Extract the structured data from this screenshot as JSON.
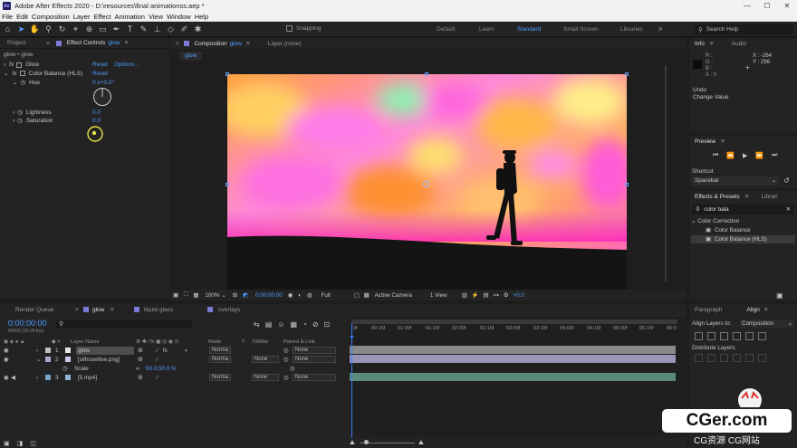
{
  "titlebar": {
    "logo": "Ae",
    "title": "Adobe After Effects 2020 - D:\\resources\\final animationss.aep *",
    "minimize": "—",
    "maximize": "☐",
    "close": "✕"
  },
  "menu": [
    "File",
    "Edit",
    "Composition",
    "Layer",
    "Effect",
    "Animation",
    "View",
    "Window",
    "Help"
  ],
  "toolbar": {
    "snapping_label": "Snapping",
    "workspaces": [
      "Default",
      "Learn",
      "Standard",
      "Small Screen",
      "Libraries"
    ],
    "active_workspace": "Standard",
    "search_placeholder": "Search Help"
  },
  "effect_controls": {
    "project_tab": "Project",
    "tab_prefix": "Effect Controls",
    "tab_layer": "glow",
    "breadcrumb": "glow • glow",
    "effects": [
      {
        "fx": "fx",
        "name": "Glow",
        "reset": "Reset",
        "options": "Options..."
      },
      {
        "fx": "fx",
        "name": "Color Balance (HLS)",
        "reset": "Reset"
      }
    ],
    "hue_label": "Hue",
    "hue_value": "0 x+0.0°",
    "lightness_label": "Lightness",
    "lightness_value": "0.0",
    "saturation_label": "Saturation",
    "saturation_value": "0.0"
  },
  "composition": {
    "tab_prefix": "Composition",
    "tab_name": "glow",
    "layer_tab": "Layer  (none)",
    "flow_label": "glow",
    "footer": {
      "zoom": "100%",
      "timecode": "0:00:00:00",
      "resolution": "Full",
      "camera": "Active Camera",
      "view": "1 View",
      "exposure": "+0.0"
    }
  },
  "info": {
    "tab": "Info",
    "audio_tab": "Audio",
    "r": "R :",
    "g": "G :",
    "b": "B :",
    "a": "A : 0",
    "x": "X : -264",
    "y": "Y : 296",
    "undo": "Undo",
    "change_value": "Change Value"
  },
  "preview": {
    "title": "Preview",
    "shortcut_label": "Shortcut",
    "shortcut_value": "Spacebar"
  },
  "effects_presets": {
    "title": "Effects & Presets",
    "libraries": "Librari",
    "search_value": "color bala",
    "category": "Color Correction",
    "items": [
      "Color Balance",
      "Color Balance (HLS)"
    ]
  },
  "align": {
    "paragraph_tab": "Paragraph",
    "align_tab": "Align",
    "align_layers_to": "Align Layers to:",
    "align_target": "Composition",
    "distribute": "Distribute Layers:"
  },
  "timeline": {
    "tabs": [
      "Render Queue",
      "glow",
      "liquid glass",
      "overlays"
    ],
    "timecode": "0:00:00:00",
    "timecode_sub": "00000 (30.00 fps)",
    "columns": {
      "layer_name": "Layer Name",
      "mode": "Mode",
      "t": "T",
      "trkmat": "TrkMat",
      "parent": "Parent & Link"
    },
    "layers": [
      {
        "num": "1",
        "name": "glow",
        "mode": "Norma",
        "trkmat": "",
        "parent": "None",
        "color": "#e6e6e6",
        "label": "#c0c0c0"
      },
      {
        "num": "2",
        "name": "[silhouettee.png]",
        "mode": "Norma",
        "trkmat": "None",
        "parent": "None",
        "color": "#cfc8e8",
        "label": "#b0a8d0"
      },
      {
        "num": "3",
        "name": "[5.mp4]",
        "mode": "Norma",
        "trkmat": "None",
        "parent": "None",
        "color": "#8fb4d8",
        "label": "#7aa3c8"
      }
    ],
    "scale_label": "Scale",
    "scale_value": "50.0,50.0 %",
    "ruler": [
      "0f",
      "00:15f",
      "01:00f",
      "01:15f",
      "02:00f",
      "02:15f",
      "03:00f",
      "03:15f",
      "04:00f",
      "04:15f",
      "05:00f",
      "05:15f",
      "06:0"
    ]
  },
  "watermark": {
    "logo_text": "CGer.com",
    "sub_text": "CG资源 CG网站"
  },
  "colors": {
    "accent": "#4c9cff",
    "panel_bg": "#232323",
    "app_bg": "#1d1d1d"
  }
}
